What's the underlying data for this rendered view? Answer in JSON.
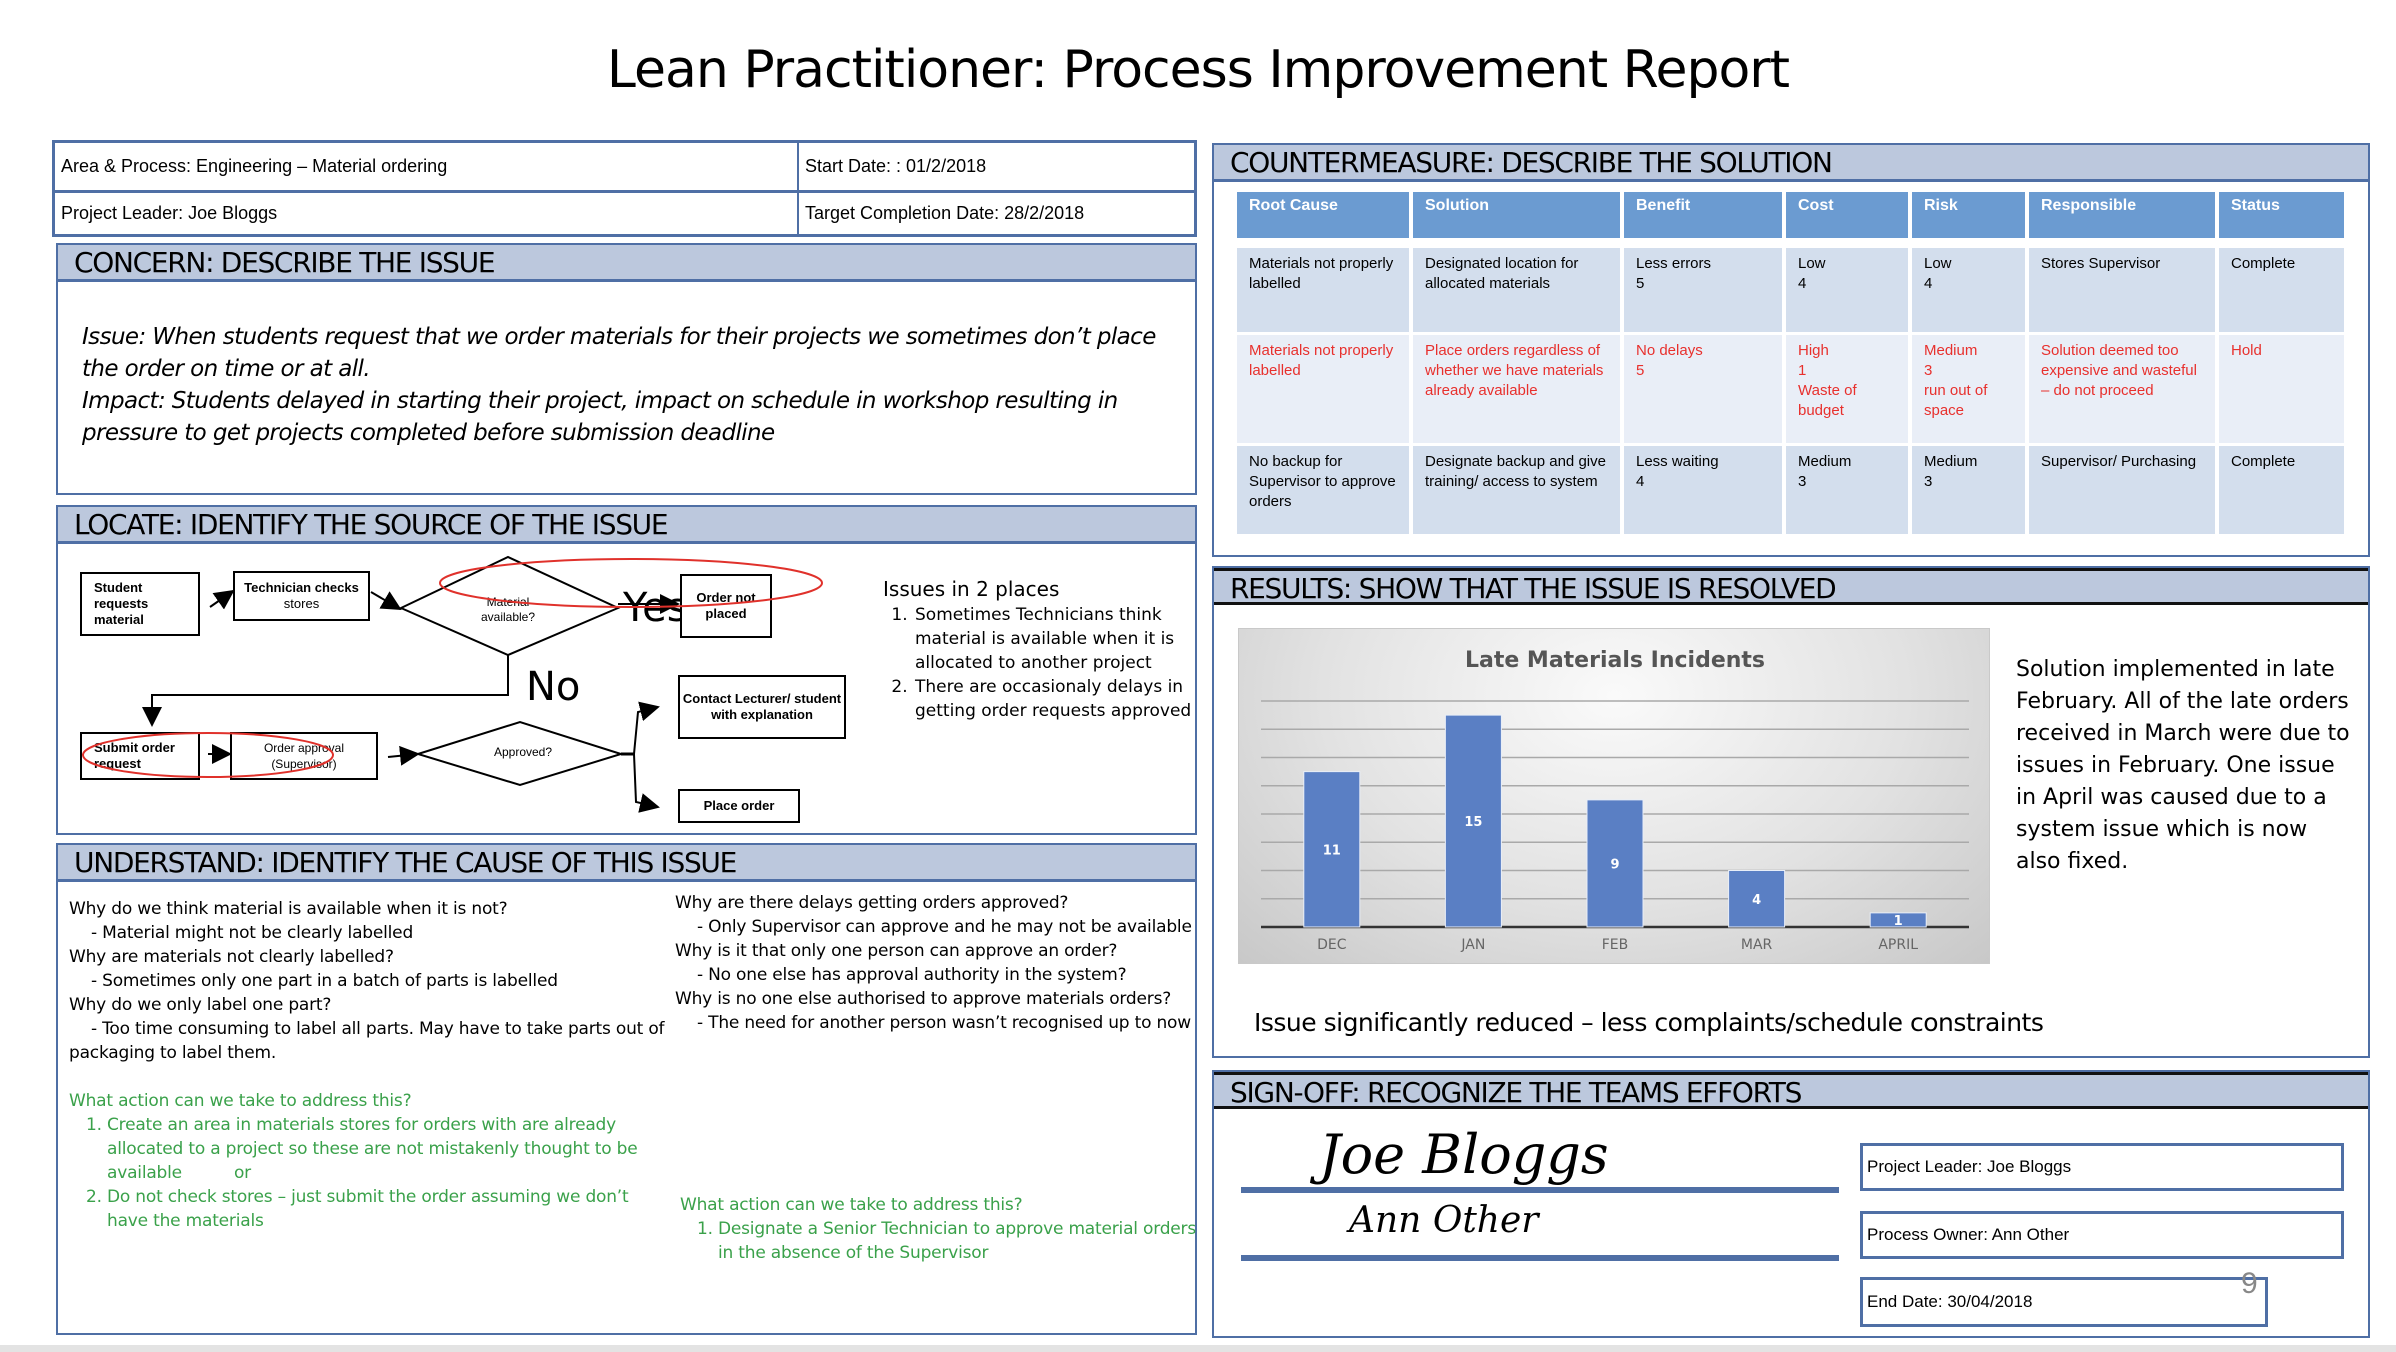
{
  "title": "Lean Practitioner: Process Improvement Report",
  "info": {
    "area_process": "Area & Process: Engineering – Material ordering",
    "start_date": "Start Date: : 01/2/2018",
    "project_leader": "Project Leader: Joe Bloggs",
    "target_completion": "Target Completion Date: 28/2/2018"
  },
  "concern": {
    "heading": "CONCERN: DESCRIBE THE ISSUE",
    "issue": "Issue: When students request that we order materials for their projects we sometimes don’t place the order on time or at all.",
    "impact": "Impact:  Students delayed in starting their project, impact on schedule in workshop resulting in pressure to get projects completed before submission deadline"
  },
  "locate": {
    "heading": "LOCATE: IDENTIFY THE SOURCE OF THE ISSUE",
    "flowchart": {
      "student_requests": "Student requests material",
      "technician_checks_bold": "Technician checks",
      "technician_checks_rest": " stores",
      "material_available": "Material available?",
      "yes_label": "Yes",
      "order_not_placed": "Order not placed",
      "no_label": "No",
      "submit_order": "Submit order request",
      "order_approval": "Order approval (Supervisor)",
      "approved": "Approved?",
      "contact_lecturer": "Contact Lecturer/ student  with explanation",
      "place_order": "Place order"
    },
    "issues_heading": "Issues in 2 places",
    "issues": [
      "Sometimes Technicians think material is available when it is allocated to another project",
      "There are occasionaly delays in getting order requests approved"
    ]
  },
  "understand": {
    "heading": "UNDERSTAND: IDENTIFY THE CAUSE OF THIS ISSUE",
    "left_whys": [
      {
        "q": "Why do we think material is available when it is not?",
        "a": "- Material might not be clearly labelled"
      },
      {
        "q": "Why are materials not clearly labelled?",
        "a": "- Sometimes only one part in a batch of parts is labelled"
      },
      {
        "q": "Why do we only label one part?",
        "a": "- Too time consuming to label all parts. May have to take parts out of"
      }
    ],
    "left_tail": "packaging to label them.",
    "left_action_heading": "What action can we take to address this?",
    "left_actions": [
      "Create an area in materials stores for orders with are already allocated to a project so these are not mistakenly thought to be available          or",
      "Do not check stores – just submit the order assuming we don’t have the materials"
    ],
    "right_whys": [
      {
        "q": "Why are there delays getting orders approved?",
        "a": "- Only Supervisor can approve and he may not be available"
      },
      {
        "q": "Why is it that only one person can approve an order?",
        "a": "- No one else has approval authority in the system?"
      },
      {
        "q": "Why is no one else authorised to approve materials orders?",
        "a": "- The need for another person wasn’t recognised up to now"
      }
    ],
    "right_action_heading": "What action can we take to address this?",
    "right_actions": [
      "Designate a Senior Technician to approve material orders in the absence of the Supervisor"
    ]
  },
  "countermeasure": {
    "heading": "COUNTERMEASURE: DESCRIBE THE SOLUTION",
    "columns": [
      "Root Cause",
      "Solution",
      "Benefit",
      "Cost",
      "Risk",
      "Responsible",
      "Status"
    ],
    "rows": [
      {
        "status_color": "#000000",
        "cells": [
          "Materials not properly labelled",
          "Designated location for allocated materials",
          "Less errors\n      5",
          "Low\n   4",
          "Low\n   4",
          "Stores Supervisor",
          "Complete"
        ]
      },
      {
        "status_color": "#e8302d",
        "cells": [
          "Materials not properly labelled",
          "Place orders regardless of whether we have materials already available",
          "No delays\n      5",
          "High\n   1\nWaste of budget",
          "Medium\n    3\nrun out of space",
          "Solution deemed too expensive and wasteful – do not proceed",
          "Hold"
        ]
      },
      {
        "status_color": "#000000",
        "cells": [
          "No backup for Supervisor to approve orders",
          "Designate backup and give training/ access to system",
          "Less waiting\n      4",
          "Medium\n    3",
          "Medium\n    3",
          "Supervisor/ Purchasing",
          "Complete"
        ]
      }
    ]
  },
  "results": {
    "heading": "RESULTS: SHOW THAT THE ISSUE IS RESOLVED",
    "explanation": "Solution implemented in late February. All of the late orders received in March were due to issues in February. One issue in April was caused due to a system issue which is now also fixed.",
    "summary": "Issue significantly reduced – less complaints/schedule constraints"
  },
  "chart_data": {
    "type": "bar",
    "title": "Late Materials Incidents",
    "categories": [
      "DEC",
      "JAN",
      "FEB",
      "MAR",
      "APRIL"
    ],
    "values": [
      11,
      15,
      9,
      4,
      1
    ],
    "xlabel": "",
    "ylabel": "",
    "ylim": [
      0,
      16
    ],
    "grid": true,
    "gridline_step": 2,
    "data_labels": true,
    "bar_color": "#5a7fc4",
    "legend": "none"
  },
  "signoff": {
    "heading": "SIGN-OFF: RECOGNIZE THE TEAMS EFFORTS",
    "signature_1": "Joe Bloggs",
    "signature_2": "Ann Other",
    "project_leader": "Project Leader: Joe Bloggs",
    "process_owner": "Process Owner: Ann Other",
    "end_date": "End Date: 30/04/2018"
  },
  "page_number": "9"
}
